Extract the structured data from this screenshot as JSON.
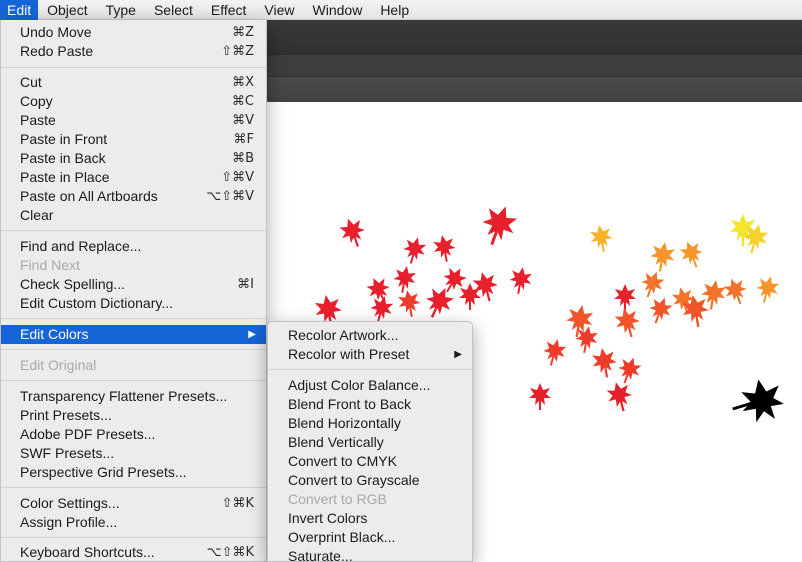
{
  "menubar": {
    "items": [
      "Edit",
      "Object",
      "Type",
      "Select",
      "Effect",
      "View",
      "Window",
      "Help"
    ]
  },
  "edit_menu": {
    "items": [
      {
        "label": "Undo Move",
        "shortcut": "⌘Z"
      },
      {
        "label": "Redo Paste",
        "shortcut": "⇧⌘Z"
      },
      {
        "label": "Cut",
        "shortcut": "⌘X"
      },
      {
        "label": "Copy",
        "shortcut": "⌘C"
      },
      {
        "label": "Paste",
        "shortcut": "⌘V"
      },
      {
        "label": "Paste in Front",
        "shortcut": "⌘F"
      },
      {
        "label": "Paste in Back",
        "shortcut": "⌘B"
      },
      {
        "label": "Paste in Place",
        "shortcut": "⇧⌘V"
      },
      {
        "label": "Paste on All Artboards",
        "shortcut": "⌥⇧⌘V"
      },
      {
        "label": "Clear",
        "shortcut": ""
      },
      {
        "label": "Find and Replace...",
        "shortcut": ""
      },
      {
        "label": "Find Next",
        "shortcut": "",
        "disabled": true
      },
      {
        "label": "Check Spelling...",
        "shortcut": "⌘I"
      },
      {
        "label": "Edit Custom Dictionary...",
        "shortcut": ""
      },
      {
        "label": "Edit Colors",
        "shortcut": "",
        "highlighted": true,
        "submenu": true
      },
      {
        "label": "Edit Original",
        "shortcut": "",
        "disabled": true
      },
      {
        "label": "Transparency Flattener Presets...",
        "shortcut": ""
      },
      {
        "label": "Print Presets...",
        "shortcut": ""
      },
      {
        "label": "Adobe PDF Presets...",
        "shortcut": ""
      },
      {
        "label": "SWF Presets...",
        "shortcut": ""
      },
      {
        "label": "Perspective Grid Presets...",
        "shortcut": ""
      },
      {
        "label": "Color Settings...",
        "shortcut": "⇧⌘K"
      },
      {
        "label": "Assign Profile...",
        "shortcut": ""
      },
      {
        "label": "Keyboard Shortcuts...",
        "shortcut": "⌥⇧⌘K"
      }
    ]
  },
  "colors_menu": {
    "items": [
      {
        "label": "Recolor Artwork..."
      },
      {
        "label": "Recolor with Preset",
        "submenu": true
      },
      {
        "label": "Adjust Color Balance..."
      },
      {
        "label": "Blend Front to Back"
      },
      {
        "label": "Blend Horizontally"
      },
      {
        "label": "Blend Vertically"
      },
      {
        "label": "Convert to CMYK"
      },
      {
        "label": "Convert to Grayscale"
      },
      {
        "label": "Convert to RGB",
        "disabled": true
      },
      {
        "label": "Invert Colors"
      },
      {
        "label": "Overprint Black..."
      },
      {
        "label": "Saturate..."
      }
    ]
  },
  "icons": {
    "submenu_arrow": "▶",
    "artwork_leaf": "maple-leaf-icon"
  },
  "colors": {
    "menu_highlight": "#1665d8",
    "menu_bg": "#ececec",
    "disabled_text": "#a9a9a9",
    "leaf_palette": [
      "#e8202c",
      "#ee3b2a",
      "#f0552a",
      "#f3732a",
      "#f7952a",
      "#f9b12a",
      "#f8d02a",
      "#f5e52a",
      "#000000"
    ]
  }
}
